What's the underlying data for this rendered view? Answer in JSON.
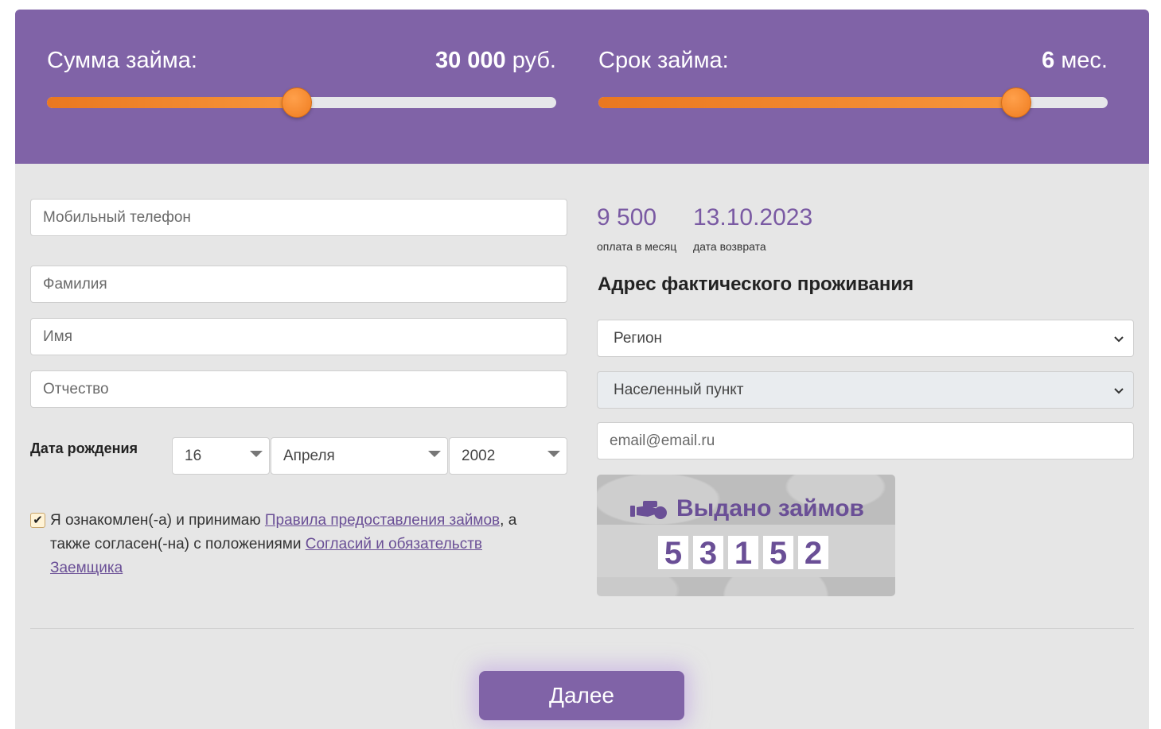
{
  "loan": {
    "amount": {
      "label": "Сумма займа:",
      "value_strong": "30 000",
      "value_unit": " руб.",
      "fraction": 0.49
    },
    "term": {
      "label": "Срок займа:",
      "value_strong": "6",
      "value_unit": " мес.",
      "fraction": 0.82
    }
  },
  "form": {
    "phone_placeholder": "Мобильный телефон",
    "surname_placeholder": "Фамилия",
    "name_placeholder": "Имя",
    "patronymic_placeholder": "Отчество",
    "dob_label": "Дата рождения",
    "dob_day": "16",
    "dob_month": "Апреля",
    "dob_year": "2002"
  },
  "calc": {
    "monthly_value": "9 500",
    "monthly_caption": "оплата в месяц",
    "return_value": "13.10.2023",
    "return_caption": "дата возврата"
  },
  "address": {
    "title": "Адрес фактического проживания",
    "region": "Регион",
    "locality": "Населенный пункт",
    "email_placeholder": "email@email.ru"
  },
  "agreement": {
    "checked": true,
    "text_1": "Я ознакомлен(-а) и принимаю ",
    "link_1": "Правила предоставления займов",
    "text_2": ", а также согласен(-на) с положениями ",
    "link_2": "Согласий и обязательств Заемщика"
  },
  "counter": {
    "title": "Выдано займов",
    "digits": [
      "5",
      "3",
      "1",
      "5",
      "2"
    ]
  },
  "next_button": "Далее",
  "colors": {
    "brand": "#8063a7",
    "accent": "#ef7c1f"
  }
}
